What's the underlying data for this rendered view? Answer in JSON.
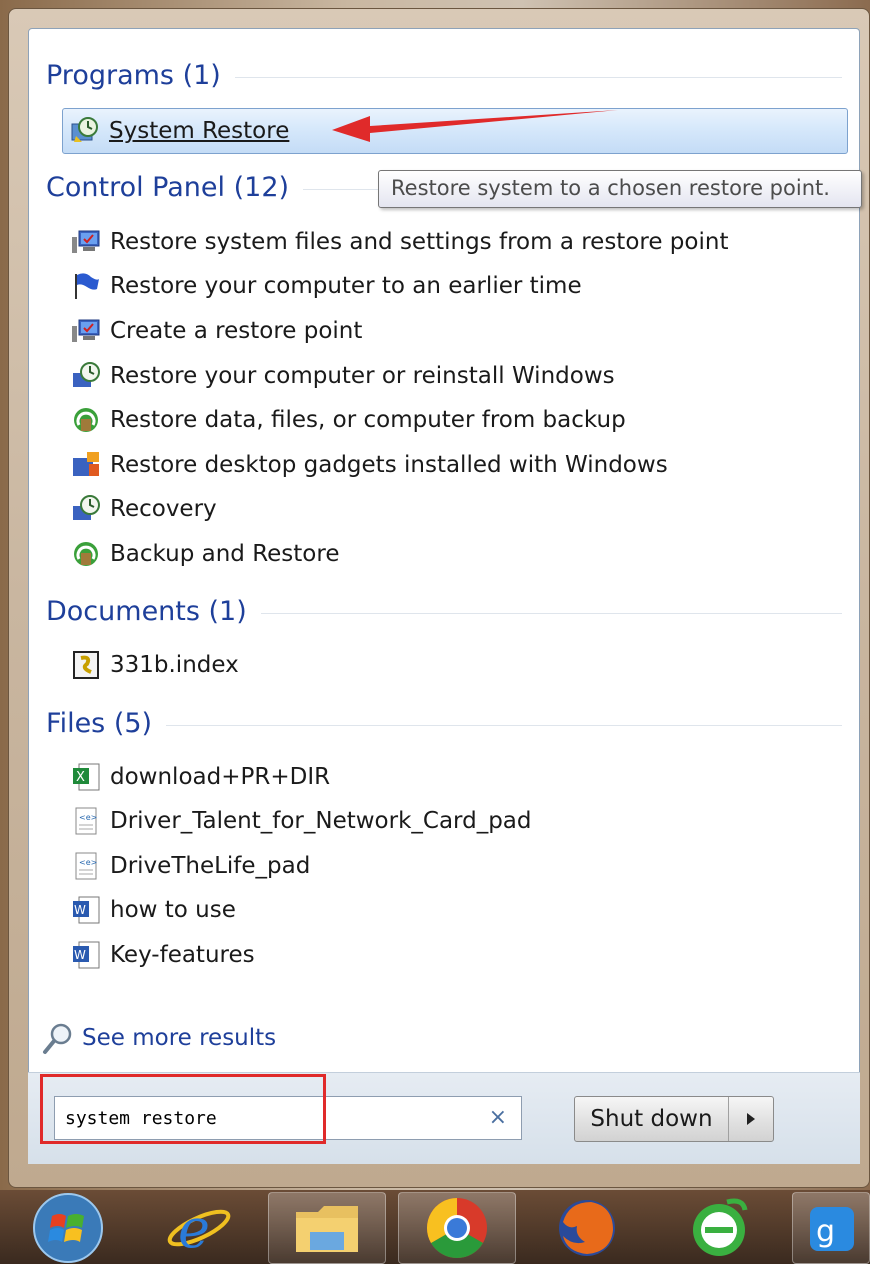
{
  "start_menu": {
    "groups": {
      "programs": {
        "title": "Programs (1)"
      },
      "control_panel": {
        "title": "Control Panel (12)"
      },
      "documents": {
        "title": "Documents (1)"
      },
      "files": {
        "title": "Files (5)"
      }
    },
    "programs_items": [
      {
        "label": "System Restore",
        "icon": "system-restore-icon"
      }
    ],
    "control_panel_items": [
      {
        "label": "Restore system files and settings from a restore point",
        "icon": "computer-monitor-icon"
      },
      {
        "label": "Restore your computer to an earlier time",
        "icon": "blue-flag-icon"
      },
      {
        "label": "Create a restore point",
        "icon": "computer-monitor-icon"
      },
      {
        "label": "Restore your computer or reinstall Windows",
        "icon": "recovery-icon"
      },
      {
        "label": "Restore data, files, or computer from backup",
        "icon": "backup-restore-icon"
      },
      {
        "label": "Restore desktop gadgets installed with Windows",
        "icon": "gadgets-icon"
      },
      {
        "label": "Recovery",
        "icon": "recovery-icon"
      },
      {
        "label": "Backup and Restore",
        "icon": "backup-restore-icon"
      }
    ],
    "documents_items": [
      {
        "label": "331b.index",
        "icon": "index-file-icon"
      }
    ],
    "files_items": [
      {
        "label": "download+PR+DIR",
        "icon": "excel-file-icon"
      },
      {
        "label": "Driver_Talent_for_Network_Card_pad",
        "icon": "pad-file-icon"
      },
      {
        "label": "DriveTheLife_pad",
        "icon": "pad-file-icon"
      },
      {
        "label": "how to use",
        "icon": "word-file-icon"
      },
      {
        "label": "Key-features",
        "icon": "word-file-icon"
      }
    ],
    "tooltip": "Restore system to a chosen restore point.",
    "see_more": "See more results",
    "search": {
      "value": "system restore"
    },
    "search_clear": "×",
    "shutdown_label": "Shut down"
  },
  "annotation_color": "#e02a2a",
  "taskbar": {
    "icons": [
      "windows-start-icon",
      "internet-explorer-icon",
      "file-explorer-icon",
      "chrome-icon",
      "firefox-icon",
      "green-browser-icon",
      "app-icon"
    ]
  }
}
